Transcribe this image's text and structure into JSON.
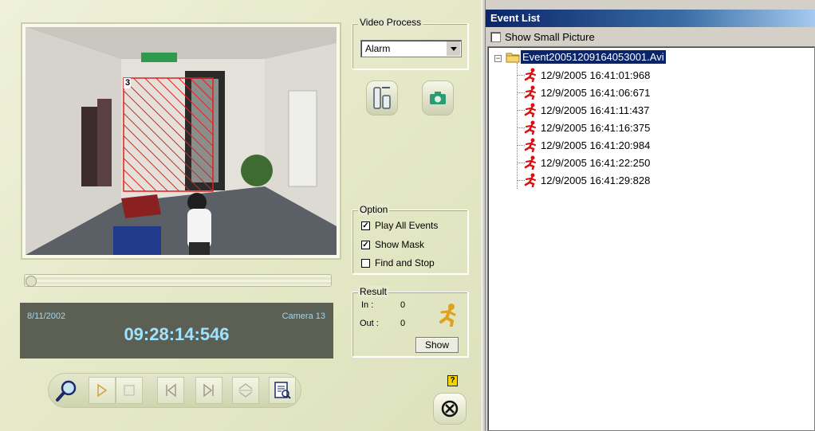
{
  "video": {
    "region_label": "3"
  },
  "video_process": {
    "legend": "Video Process",
    "selected": "Alarm"
  },
  "info": {
    "date": "8/11/2002",
    "camera": "Camera 13",
    "time": "09:28:14:546"
  },
  "option": {
    "legend": "Option",
    "play_all_events": {
      "label": "Play All Events",
      "checked": true
    },
    "show_mask": {
      "label": "Show Mask",
      "checked": true
    },
    "find_and_stop": {
      "label": "Find and Stop",
      "checked": false
    }
  },
  "result": {
    "legend": "Result",
    "in_label": "In :",
    "in_value": "0",
    "out_label": "Out :",
    "out_value": "0",
    "show_button": "Show"
  },
  "help_label": "?",
  "event_list": {
    "title": "Event List",
    "show_small_picture": "Show Small Picture",
    "root_file": "Event20051209164053001.Avi",
    "events": [
      "12/9/2005 16:41:01:968",
      "12/9/2005 16:41:06:671",
      "12/9/2005 16:41:11:437",
      "12/9/2005 16:41:16:375",
      "12/9/2005 16:41:20:984",
      "12/9/2005 16:41:22:250",
      "12/9/2005 16:41:29:828"
    ]
  },
  "colors": {
    "title_bar": "#0a246a",
    "info_text": "#9fe3ff",
    "mask": "#e02020",
    "event_icon": "#d81010"
  },
  "icons": {
    "zoom": "magnifier-icon",
    "play": "play-icon",
    "stop": "stop-icon",
    "prev": "skip-back-icon",
    "next": "skip-forward-icon",
    "updown": "up-down-icon",
    "report": "report-icon",
    "tools": "tools-icon",
    "camera": "camera-icon",
    "runner": "running-man-icon",
    "close": "close-circle-icon"
  }
}
